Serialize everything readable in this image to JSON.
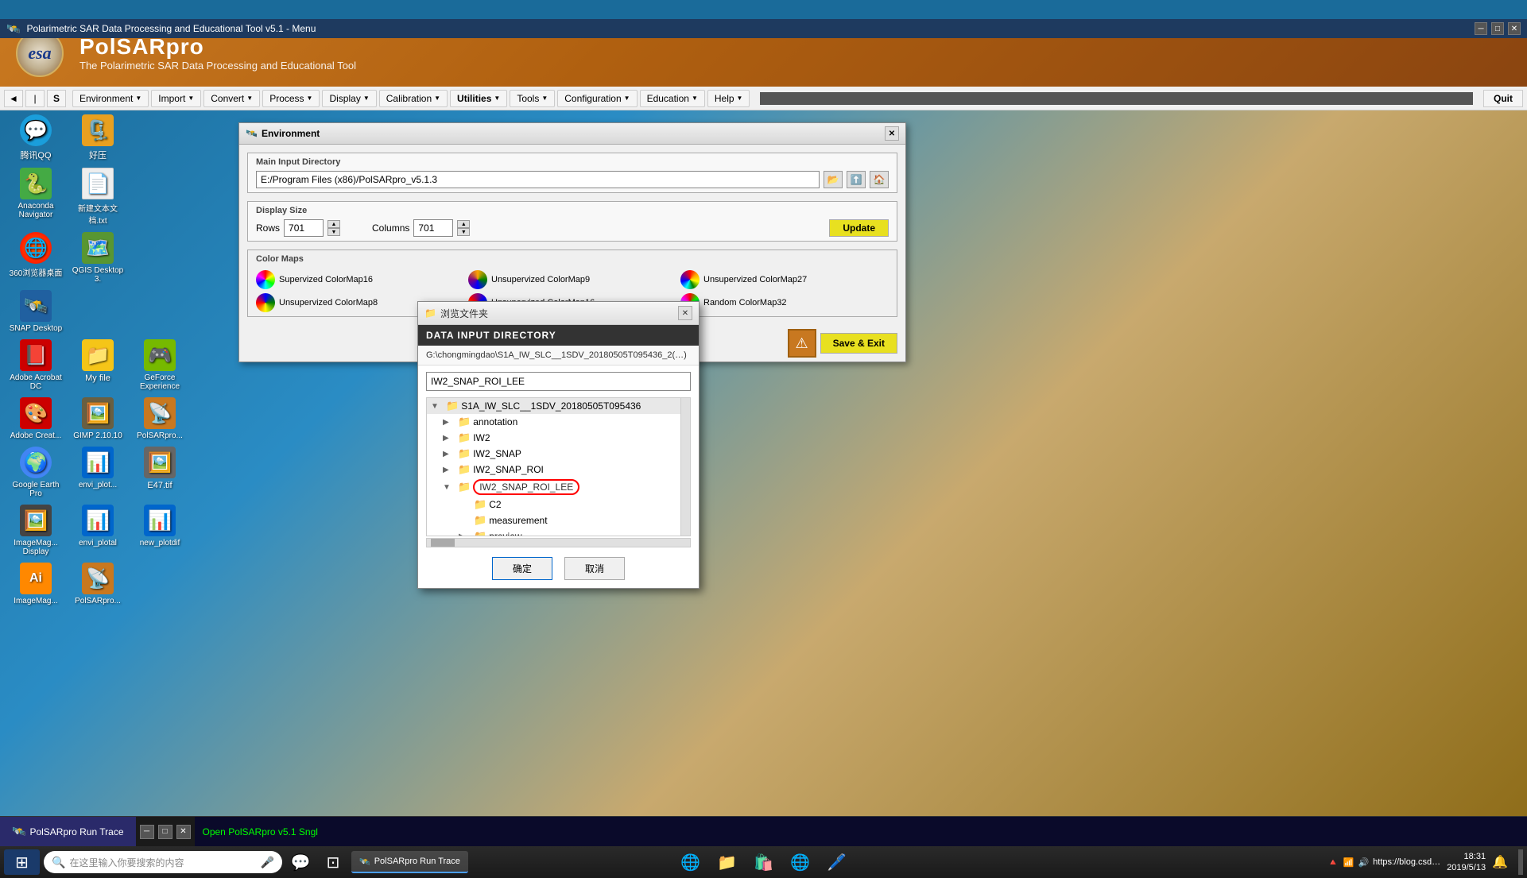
{
  "window": {
    "title": "Polarimetric SAR Data Processing and Educational Tool v5.1 - Menu",
    "app_name": "PolSARpro",
    "app_subtitle": "The Polarimetric SAR Data Processing and Educational Tool"
  },
  "esa": {
    "logo_text": "esa"
  },
  "menubar": {
    "items": [
      {
        "label": "Environment",
        "id": "environment"
      },
      {
        "label": "Import",
        "id": "import"
      },
      {
        "label": "Convert",
        "id": "convert"
      },
      {
        "label": "Process",
        "id": "process"
      },
      {
        "label": "Display",
        "id": "display"
      },
      {
        "label": "Calibration",
        "id": "calibration"
      },
      {
        "label": "Utilities",
        "id": "utilities"
      },
      {
        "label": "Tools",
        "id": "tools"
      },
      {
        "label": "Configuration",
        "id": "configuration"
      },
      {
        "label": "Education",
        "id": "education"
      },
      {
        "label": "Help",
        "id": "help"
      }
    ],
    "quit_label": "Quit"
  },
  "environment_window": {
    "title": "Environment",
    "main_input_dir_label": "Main Input Directory",
    "main_input_path": "E:/Program Files (x86)/PolSARpro_v5.1.3",
    "display_size_label": "Display Size",
    "rows_label": "Rows",
    "rows_value": "701",
    "columns_label": "Columns",
    "columns_value": "701",
    "update_label": "Update",
    "color_maps_label": "Color Maps",
    "color_maps": [
      {
        "label": "Supervized ColorMap16"
      },
      {
        "label": "Unsupervized ColorMap9"
      },
      {
        "label": "Unsupervized ColorMap27"
      },
      {
        "label": "Unsupervized ColorMap8"
      },
      {
        "label": "Unsupervized ColorMap16"
      },
      {
        "label": "Random ColorMap32"
      }
    ],
    "save_exit_label": "Save & Exit"
  },
  "file_dialog": {
    "title": "浏览文件夹",
    "header": "DATA INPUT DIRECTORY",
    "path": "G:\\chongmingdao\\S1A_IW_SLC__1SDV_20180505T095436_2(…)",
    "search_value": "IW2_SNAP_ROI_LEE",
    "tree": [
      {
        "label": "S1A_IW_SLC__1SDV_20180505T095436",
        "level": 0,
        "expanded": true,
        "has_children": true
      },
      {
        "label": "annotation",
        "level": 1,
        "expanded": false,
        "has_children": true
      },
      {
        "label": "IW2",
        "level": 1,
        "expanded": false,
        "has_children": true
      },
      {
        "label": "IW2_SNAP",
        "level": 1,
        "expanded": false,
        "has_children": true
      },
      {
        "label": "IW2_SNAP_ROI",
        "level": 1,
        "expanded": false,
        "has_children": true
      },
      {
        "label": "IW2_SNAP_ROI_LEE",
        "level": 1,
        "expanded": true,
        "has_children": true,
        "selected": true
      },
      {
        "label": "C2",
        "level": 2,
        "expanded": false,
        "has_children": false
      },
      {
        "label": "measurement",
        "level": 2,
        "expanded": false,
        "has_children": false
      },
      {
        "label": "preview",
        "level": 2,
        "expanded": false,
        "has_children": true
      }
    ],
    "confirm_label": "确定",
    "cancel_label": "取消"
  },
  "run_trace": {
    "title": "PolSARpro Run Trace",
    "content": "Open PolSARpro v5.1 Sngl"
  },
  "taskbar": {
    "search_placeholder": "在这里输入你要搜索的内容",
    "time": "18:31",
    "date": "2019/5/13",
    "apps": [
      {
        "label": "PolSARpro Run Trace"
      }
    ]
  },
  "desktop_icons": [
    {
      "label": "腾讯QQ",
      "icon": "💬",
      "color": "#1a9edb"
    },
    {
      "label": "好压",
      "icon": "🗜️",
      "color": "#e8a020"
    },
    {
      "label": "Anaconda Navigator",
      "icon": "🐍",
      "color": "#44aa44"
    },
    {
      "label": "新建文本文档.txt",
      "icon": "📄",
      "color": "#ffffff"
    },
    {
      "label": "360浏览器桌面",
      "icon": "🌐",
      "color": "#1a8ad4"
    },
    {
      "label": "QGIS Desktop 3.",
      "icon": "🗺️",
      "color": "#589632"
    },
    {
      "label": "SNAP Desktop",
      "icon": "🛰️",
      "color": "#2060a0"
    },
    {
      "label": "Adobe Acrobat DC",
      "icon": "📕",
      "color": "#cc0000"
    },
    {
      "label": "My file",
      "icon": "📁",
      "color": "#f5c518"
    },
    {
      "label": "GeForce Experience",
      "icon": "🎮",
      "color": "#76b900"
    },
    {
      "label": "Adobe Creat...",
      "icon": "🎨",
      "color": "#cc0000"
    },
    {
      "label": "GIMP 2.10.10",
      "icon": "🖼️",
      "color": "#695f42"
    },
    {
      "label": "PolSARpro...",
      "icon": "📡",
      "color": "#c87820"
    },
    {
      "label": "Google Earth Pro",
      "icon": "🌍",
      "color": "#4285f4"
    },
    {
      "label": "envi_plot...",
      "icon": "📊",
      "color": "#0066cc"
    },
    {
      "label": "E47.tif",
      "icon": "🖼️",
      "color": "#666666"
    },
    {
      "label": "ImageMag... Display",
      "icon": "🖼️",
      "color": "#444444"
    },
    {
      "label": "envi_plotal",
      "icon": "📊",
      "color": "#0066cc"
    },
    {
      "label": "new_plotdif",
      "icon": "📊",
      "color": "#0066cc"
    },
    {
      "label": "PolSARpro...",
      "icon": "📡",
      "color": "#c87820"
    }
  ]
}
